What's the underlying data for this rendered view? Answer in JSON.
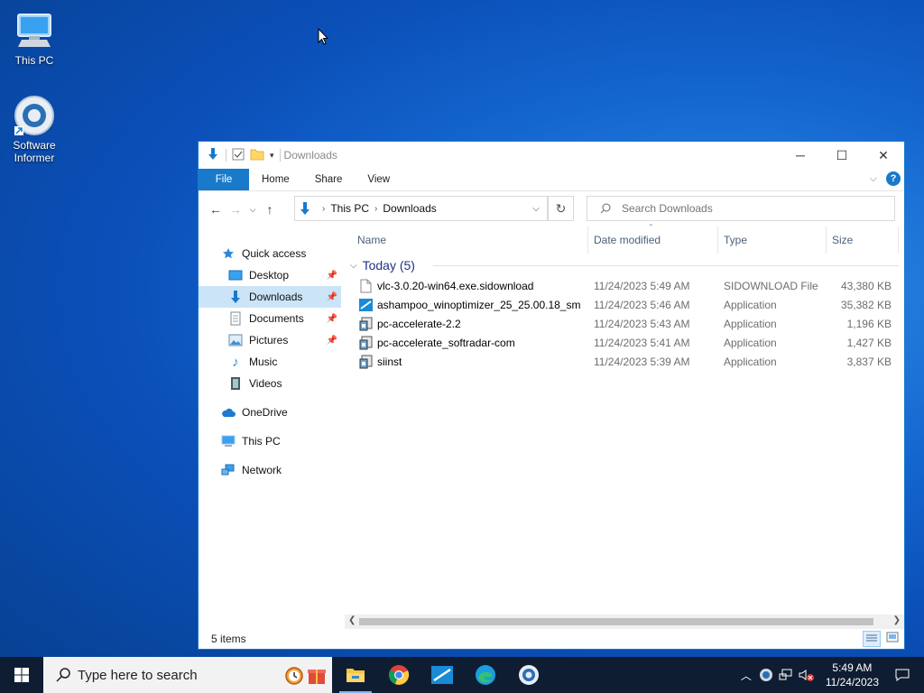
{
  "desktop": {
    "icons": [
      {
        "label": "This PC",
        "icon": "computer-icon"
      },
      {
        "label": "Software\nInformer",
        "icon": "software-informer-icon"
      }
    ]
  },
  "window": {
    "title": "Downloads",
    "ribbon_tabs": [
      "File",
      "Home",
      "Share",
      "View"
    ],
    "address": {
      "crumbs": [
        "This PC",
        "Downloads"
      ]
    },
    "search_placeholder": "Search Downloads",
    "nav_items": [
      {
        "label": "Quick access",
        "icon": "star-icon",
        "indent": false,
        "pinned": false,
        "selected": false
      },
      {
        "label": "Desktop",
        "icon": "desktop-folder-icon",
        "indent": true,
        "pinned": true,
        "selected": false
      },
      {
        "label": "Downloads",
        "icon": "download-icon",
        "indent": true,
        "pinned": true,
        "selected": true
      },
      {
        "label": "Documents",
        "icon": "documents-icon",
        "indent": true,
        "pinned": true,
        "selected": false
      },
      {
        "label": "Pictures",
        "icon": "pictures-icon",
        "indent": true,
        "pinned": true,
        "selected": false
      },
      {
        "label": "Music",
        "icon": "music-icon",
        "indent": true,
        "pinned": false,
        "selected": false
      },
      {
        "label": "Videos",
        "icon": "videos-icon",
        "indent": true,
        "pinned": false,
        "selected": false
      },
      {
        "label": "OneDrive",
        "icon": "cloud-icon",
        "indent": false,
        "pinned": false,
        "selected": false
      },
      {
        "label": "This PC",
        "icon": "computer-icon",
        "indent": false,
        "pinned": false,
        "selected": false
      },
      {
        "label": "Network",
        "icon": "network-icon",
        "indent": false,
        "pinned": false,
        "selected": false
      }
    ],
    "columns": {
      "name": "Name",
      "date": "Date modified",
      "type": "Type",
      "size": "Size"
    },
    "group_label": "Today (5)",
    "files": [
      {
        "name": "vlc-3.0.20-win64.exe.sidownload",
        "date": "11/24/2023 5:49 AM",
        "type": "SIDOWNLOAD File",
        "size": "43,380 KB",
        "icon": "blank-file-icon"
      },
      {
        "name": "ashampoo_winoptimizer_25_25.00.18_sm",
        "date": "11/24/2023 5:46 AM",
        "type": "Application",
        "size": "35,382 KB",
        "icon": "ashampoo-app-icon"
      },
      {
        "name": "pc-accelerate-2.2",
        "date": "11/24/2023 5:43 AM",
        "type": "Application",
        "size": "1,196 KB",
        "icon": "installer-icon"
      },
      {
        "name": "pc-accelerate_softradar-com",
        "date": "11/24/2023 5:41 AM",
        "type": "Application",
        "size": "1,427 KB",
        "icon": "installer-icon"
      },
      {
        "name": "siinst",
        "date": "11/24/2023 5:39 AM",
        "type": "Application",
        "size": "3,837 KB",
        "icon": "installer-icon"
      }
    ],
    "status": "5 items"
  },
  "taskbar": {
    "search_placeholder": "Type here to search",
    "apps": [
      "file-explorer-icon",
      "chrome-icon",
      "ashampoo-icon",
      "edge-icon",
      "software-informer-icon"
    ],
    "time": "5:49 AM",
    "date": "11/24/2023"
  },
  "colors": {
    "accent": "#1979ca",
    "selection": "#cce4f7",
    "taskbar": "#0f1d33",
    "group_text": "#1e3287"
  }
}
